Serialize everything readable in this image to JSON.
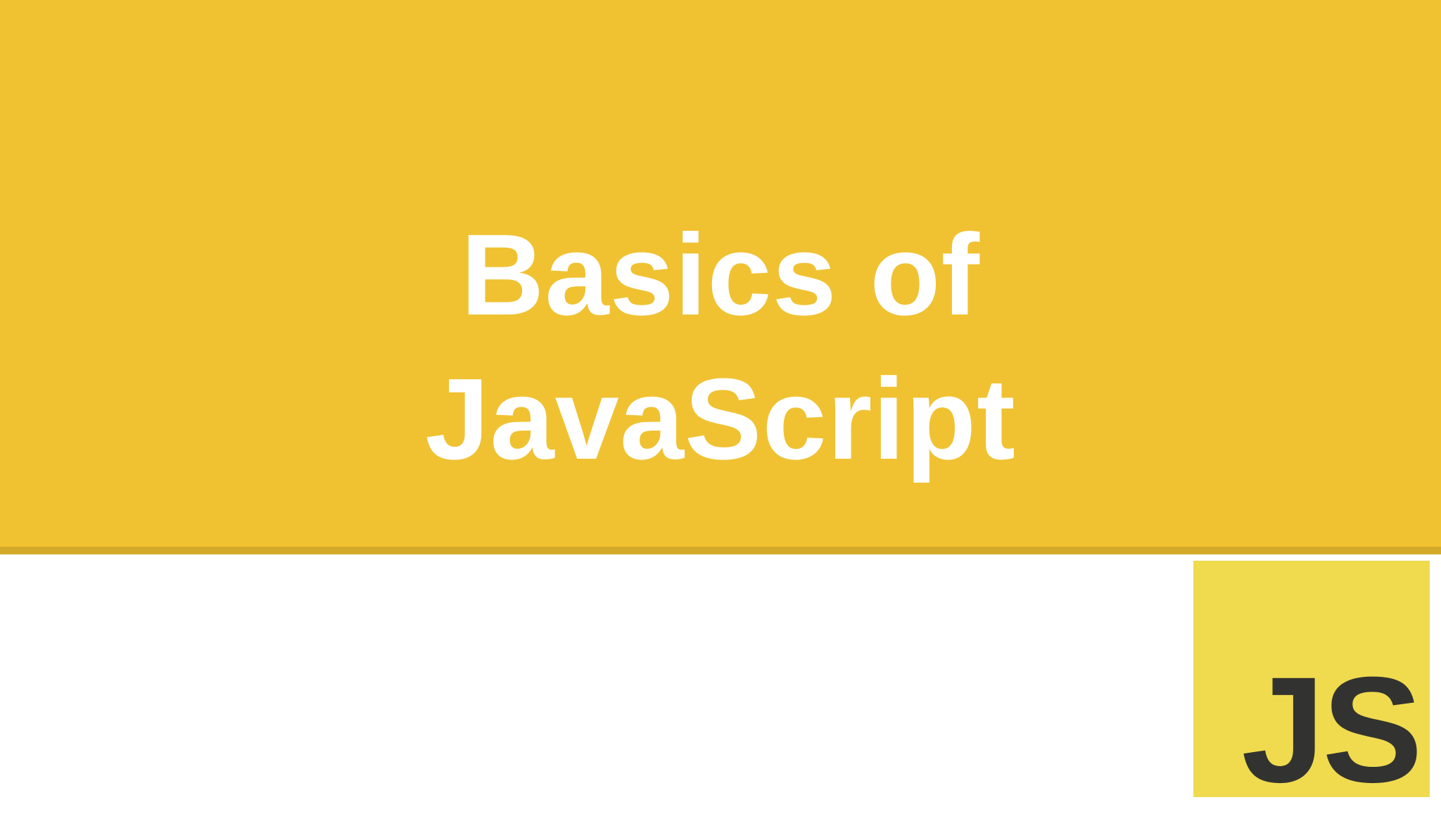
{
  "slide": {
    "title_line_1": "Basics of",
    "title_line_2": "JavaScript",
    "logo_text": "JS"
  },
  "colors": {
    "banner": "#f0c232",
    "banner_rule": "#d4a92a",
    "title_text": "#ffffff",
    "logo_background": "#f0db4f",
    "logo_text": "#323330",
    "page_background": "#ffffff"
  },
  "icons": {
    "logo": "javascript-logo-icon"
  }
}
